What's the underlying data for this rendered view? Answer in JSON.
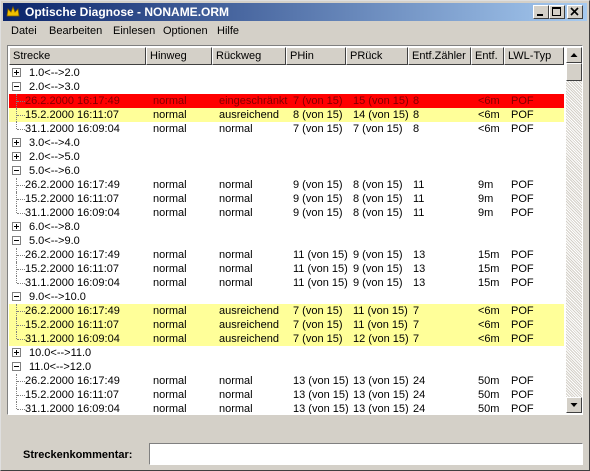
{
  "window": {
    "title": "Optische Diagnose - NONAME.ORM"
  },
  "menu": [
    "Datei",
    "Bearbeiten",
    "Einlesen",
    "Optionen",
    "Hilfe"
  ],
  "columns": [
    "Strecke",
    "Hinweg",
    "Rückweg",
    "PHin",
    "PRück",
    "Entf.Zähler",
    "Entf.",
    "LWL-Typ"
  ],
  "colors": {
    "error": "#ff0000",
    "warning": "#ffff99",
    "titlebar": "#0a246a"
  },
  "rows": [
    {
      "kind": "group",
      "label": "1.0<-->2.0",
      "expanded": false
    },
    {
      "kind": "group",
      "label": "2.0<-->3.0",
      "expanded": true
    },
    {
      "kind": "entry",
      "status": "error",
      "cells": [
        "26.2.2000 16:17:49",
        "normal",
        "eingeschränkt",
        "7 (von 15)",
        "15 (von 15)",
        "8",
        "<6m",
        "POF"
      ]
    },
    {
      "kind": "entry",
      "status": "warning",
      "cells": [
        "15.2.2000 16:11:07",
        "normal",
        "ausreichend",
        "8 (von 15)",
        "14 (von 15)",
        "8",
        "<6m",
        "POF"
      ]
    },
    {
      "kind": "entry",
      "status": "ok",
      "last": true,
      "cells": [
        "31.1.2000 16:09:04",
        "normal",
        "normal",
        "7 (von 15)",
        "7 (von 15)",
        "8",
        "<6m",
        "POF"
      ]
    },
    {
      "kind": "group",
      "label": "3.0<-->4.0",
      "expanded": false
    },
    {
      "kind": "group",
      "label": "2.0<-->5.0",
      "expanded": false
    },
    {
      "kind": "group",
      "label": "5.0<-->6.0",
      "expanded": true
    },
    {
      "kind": "entry",
      "status": "ok",
      "cells": [
        "26.2.2000 16:17:49",
        "normal",
        "normal",
        "9 (von 15)",
        "8 (von 15)",
        "11",
        "9m",
        "POF"
      ]
    },
    {
      "kind": "entry",
      "status": "ok",
      "cells": [
        "15.2.2000 16:11:07",
        "normal",
        "normal",
        "9 (von 15)",
        "8 (von 15)",
        "11",
        "9m",
        "POF"
      ]
    },
    {
      "kind": "entry",
      "status": "ok",
      "last": true,
      "cells": [
        "31.1.2000 16:09:04",
        "normal",
        "normal",
        "9 (von 15)",
        "8 (von 15)",
        "11",
        "9m",
        "POF"
      ]
    },
    {
      "kind": "group",
      "label": "6.0<-->8.0",
      "expanded": false
    },
    {
      "kind": "group",
      "label": "5.0<-->9.0",
      "expanded": true
    },
    {
      "kind": "entry",
      "status": "ok",
      "cells": [
        "26.2.2000 16:17:49",
        "normal",
        "normal",
        "11 (von 15)",
        "9 (von 15)",
        "13",
        "15m",
        "POF"
      ]
    },
    {
      "kind": "entry",
      "status": "ok",
      "cells": [
        "15.2.2000 16:11:07",
        "normal",
        "normal",
        "11 (von 15)",
        "9 (von 15)",
        "13",
        "15m",
        "POF"
      ]
    },
    {
      "kind": "entry",
      "status": "ok",
      "last": true,
      "cells": [
        "31.1.2000 16:09:04",
        "normal",
        "normal",
        "11 (von 15)",
        "9 (von 15)",
        "13",
        "15m",
        "POF"
      ]
    },
    {
      "kind": "group",
      "label": "9.0<-->10.0",
      "expanded": true
    },
    {
      "kind": "entry",
      "status": "warning",
      "cells": [
        "26.2.2000 16:17:49",
        "normal",
        "ausreichend",
        "7 (von 15)",
        "11 (von 15)",
        "7",
        "<6m",
        "POF"
      ]
    },
    {
      "kind": "entry",
      "status": "warning",
      "cells": [
        "15.2.2000 16:11:07",
        "normal",
        "ausreichend",
        "7 (von 15)",
        "11 (von 15)",
        "7",
        "<6m",
        "POF"
      ]
    },
    {
      "kind": "entry",
      "status": "warning",
      "last": true,
      "cells": [
        "31.1.2000 16:09:04",
        "normal",
        "ausreichend",
        "7 (von 15)",
        "12 (von 15)",
        "7",
        "<6m",
        "POF"
      ]
    },
    {
      "kind": "group",
      "label": "10.0<-->11.0",
      "expanded": false
    },
    {
      "kind": "group",
      "label": "11.0<-->12.0",
      "expanded": true
    },
    {
      "kind": "entry",
      "status": "ok",
      "cells": [
        "26.2.2000 16:17:49",
        "normal",
        "normal",
        "13 (von 15)",
        "13 (von 15)",
        "24",
        "50m",
        "POF"
      ]
    },
    {
      "kind": "entry",
      "status": "ok",
      "cells": [
        "15.2.2000 16:11:07",
        "normal",
        "normal",
        "13 (von 15)",
        "13 (von 15)",
        "24",
        "50m",
        "POF"
      ]
    },
    {
      "kind": "entry",
      "status": "ok",
      "last": true,
      "cells": [
        "31.1.2000 16:09:04",
        "normal",
        "normal",
        "13 (von 15)",
        "13 (von 15)",
        "24",
        "50m",
        "POF"
      ]
    }
  ],
  "footer": {
    "label": "Streckenkommentar:",
    "value": ""
  }
}
